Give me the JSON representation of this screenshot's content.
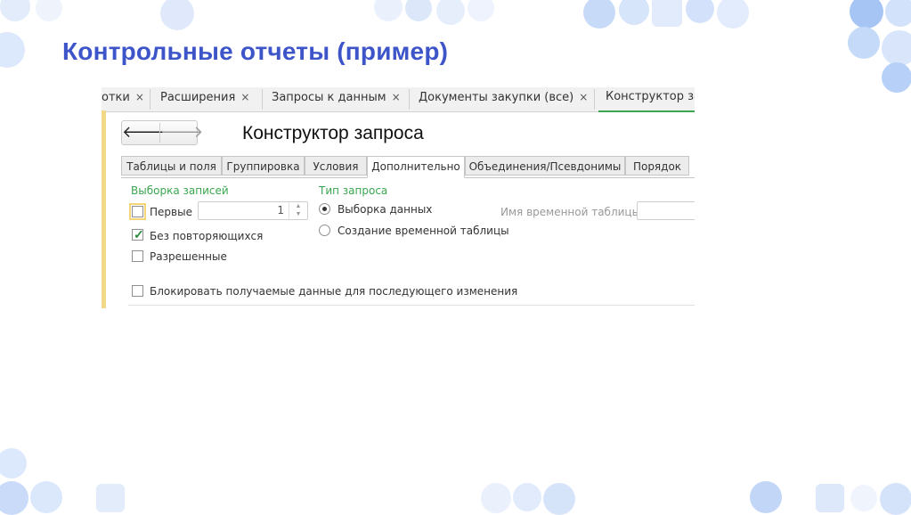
{
  "slide": {
    "title": "Контрольные отчеты (пример)"
  },
  "colors": {
    "title": "#3d55c9",
    "accent_green": "#3aa64f",
    "deco_blue": "#a9c7f5",
    "deco_light": "#dce8fb"
  },
  "window_tabs": [
    {
      "label": "отки",
      "closable": true
    },
    {
      "label": "Расширения",
      "closable": true
    },
    {
      "label": "Запросы к данным",
      "closable": true
    },
    {
      "label": "Документы закупки (все)",
      "closable": true
    },
    {
      "label": "Конструктор за",
      "closable": false,
      "active": true
    }
  ],
  "close_glyph": "×",
  "nav": {
    "back_icon": "arrow-left-icon",
    "forward_icon": "arrow-right-icon",
    "back_glyph": "🡐",
    "forward_glyph": "🡒"
  },
  "form": {
    "title": "Конструктор запроса"
  },
  "query_tabs": [
    "Таблицы и поля",
    "Группировка",
    "Условия",
    "Дополнительно",
    "Объединения/Псевдонимы",
    "Порядок"
  ],
  "active_query_tab": "Дополнительно",
  "records_selection": {
    "heading": "Выборка записей",
    "first": {
      "label": "Первые",
      "checked": false,
      "value": "1"
    },
    "distinct": {
      "label": "Без повторяющихся",
      "checked": true
    },
    "allowed": {
      "label": "Разрешенные",
      "checked": false
    }
  },
  "query_type": {
    "heading": "Тип запроса",
    "options": [
      {
        "label": "Выборка данных",
        "selected": true
      },
      {
        "label": "Создание временной таблицы",
        "selected": false
      }
    ]
  },
  "temp_table": {
    "label": "Имя временной таблицы:",
    "value": ""
  },
  "lock": {
    "label": "Блокировать получаемые данные для последующего изменения",
    "checked": false
  }
}
